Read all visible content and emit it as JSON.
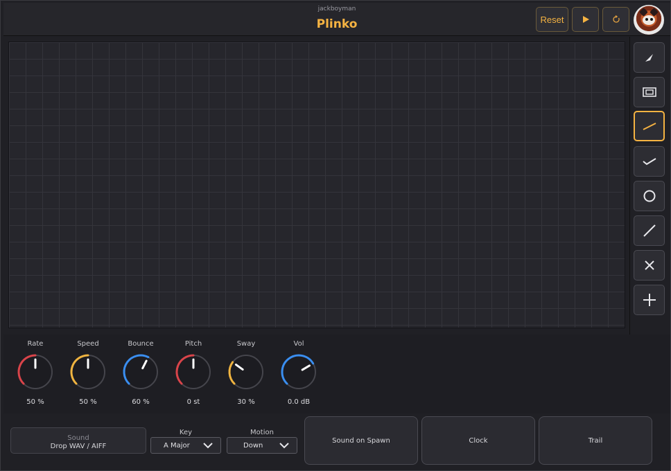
{
  "header": {
    "author": "jackboyman",
    "title": "Plinko",
    "reset_label": "Reset",
    "play_icon": "play-icon",
    "loop_icon": "loop-icon"
  },
  "colors": {
    "accent": "#f5b342",
    "knob_red": "#d9444a",
    "knob_yellow": "#f0b440",
    "knob_blue": "#3a8ef0"
  },
  "tools": [
    {
      "name": "pen-tool",
      "icon": "pen-icon",
      "active": false
    },
    {
      "name": "box-tool",
      "icon": "box-icon",
      "active": false
    },
    {
      "name": "line-tool",
      "icon": "line-icon",
      "active": true
    },
    {
      "name": "zigzag-tool",
      "icon": "chevron-icon",
      "active": false
    },
    {
      "name": "circle-tool",
      "icon": "circle-icon",
      "active": false
    },
    {
      "name": "diagonal-tool",
      "icon": "diagonal-line-icon",
      "active": false
    },
    {
      "name": "delete-tool",
      "icon": "close-icon",
      "active": false
    },
    {
      "name": "add-tool",
      "icon": "plus-icon",
      "active": false
    }
  ],
  "knobs": [
    {
      "label": "Rate",
      "value": "50 %",
      "level": 0.5,
      "color": "#d9444a"
    },
    {
      "label": "Speed",
      "value": "50 %",
      "level": 0.5,
      "color": "#f0b440"
    },
    {
      "label": "Bounce",
      "value": "60 %",
      "level": 0.6,
      "color": "#3a8ef0"
    },
    {
      "label": "Pitch",
      "value": "0 st",
      "level": 0.5,
      "color": "#d9444a"
    },
    {
      "label": "Sway",
      "value": "30 %",
      "level": 0.3,
      "color": "#f0b440"
    },
    {
      "label": "Vol",
      "value": "0.0 dB",
      "level": 0.72,
      "color": "#3a8ef0"
    }
  ],
  "sound": {
    "label": "Sound",
    "hint": "Drop WAV / AIFF"
  },
  "key": {
    "label": "Key",
    "value": "A Major"
  },
  "motion": {
    "label": "Motion",
    "value": "Down"
  },
  "actions": {
    "sound_on_spawn": "Sound on Spawn",
    "clock": "Clock",
    "trail": "Trail"
  }
}
